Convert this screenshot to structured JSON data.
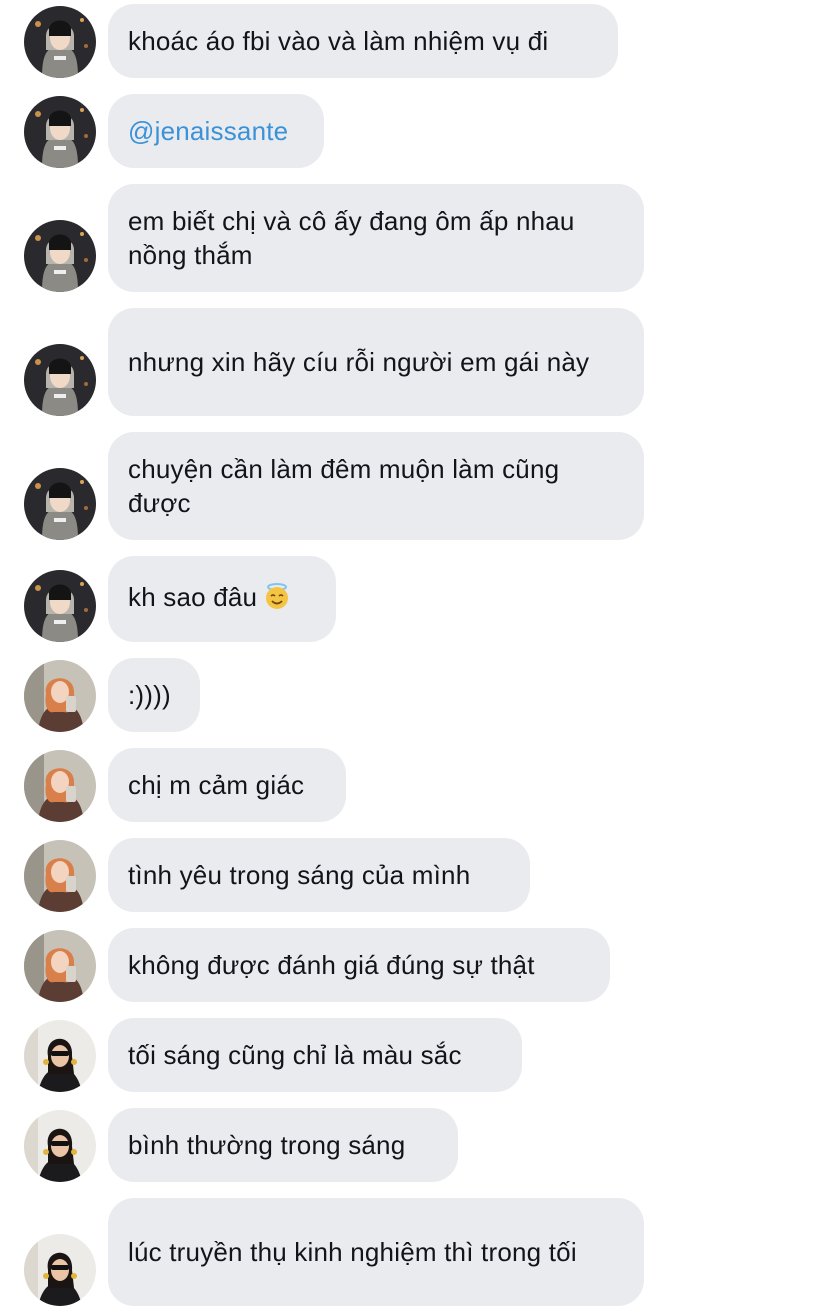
{
  "messages": [
    {
      "sender": "user-a",
      "text": "khoác áo fbi vào và làm nhiệm vụ đi"
    },
    {
      "sender": "user-a",
      "text": "@jenaissante",
      "mention": true
    },
    {
      "sender": "user-a",
      "text": "em biết chị và cô ấy đang ôm ấp nhau nồng thắm"
    },
    {
      "sender": "user-a",
      "text": "nhưng xin hãy cíu rỗi người em gái này"
    },
    {
      "sender": "user-a",
      "text": "chuyện cần làm đêm muộn làm cũng được"
    },
    {
      "sender": "user-a",
      "text": "kh sao đâu",
      "emoji": "smiling-face-with-halo-emoji"
    },
    {
      "sender": "user-b",
      "text": ":))))"
    },
    {
      "sender": "user-b",
      "text": "chị m cảm giác"
    },
    {
      "sender": "user-b",
      "text": "tình yêu trong sáng của mình"
    },
    {
      "sender": "user-b",
      "text": "không được đánh giá đúng sự thật"
    },
    {
      "sender": "user-c",
      "text": "tối sáng cũng chỉ là màu sắc"
    },
    {
      "sender": "user-c",
      "text": "bình thường trong sáng"
    },
    {
      "sender": "user-c",
      "text": "lúc truyền thụ kinh nghiệm thì trong tối"
    }
  ],
  "colors": {
    "bubble_background": "#e9ebef",
    "text": "#111418",
    "mention": "#3a92d8"
  }
}
